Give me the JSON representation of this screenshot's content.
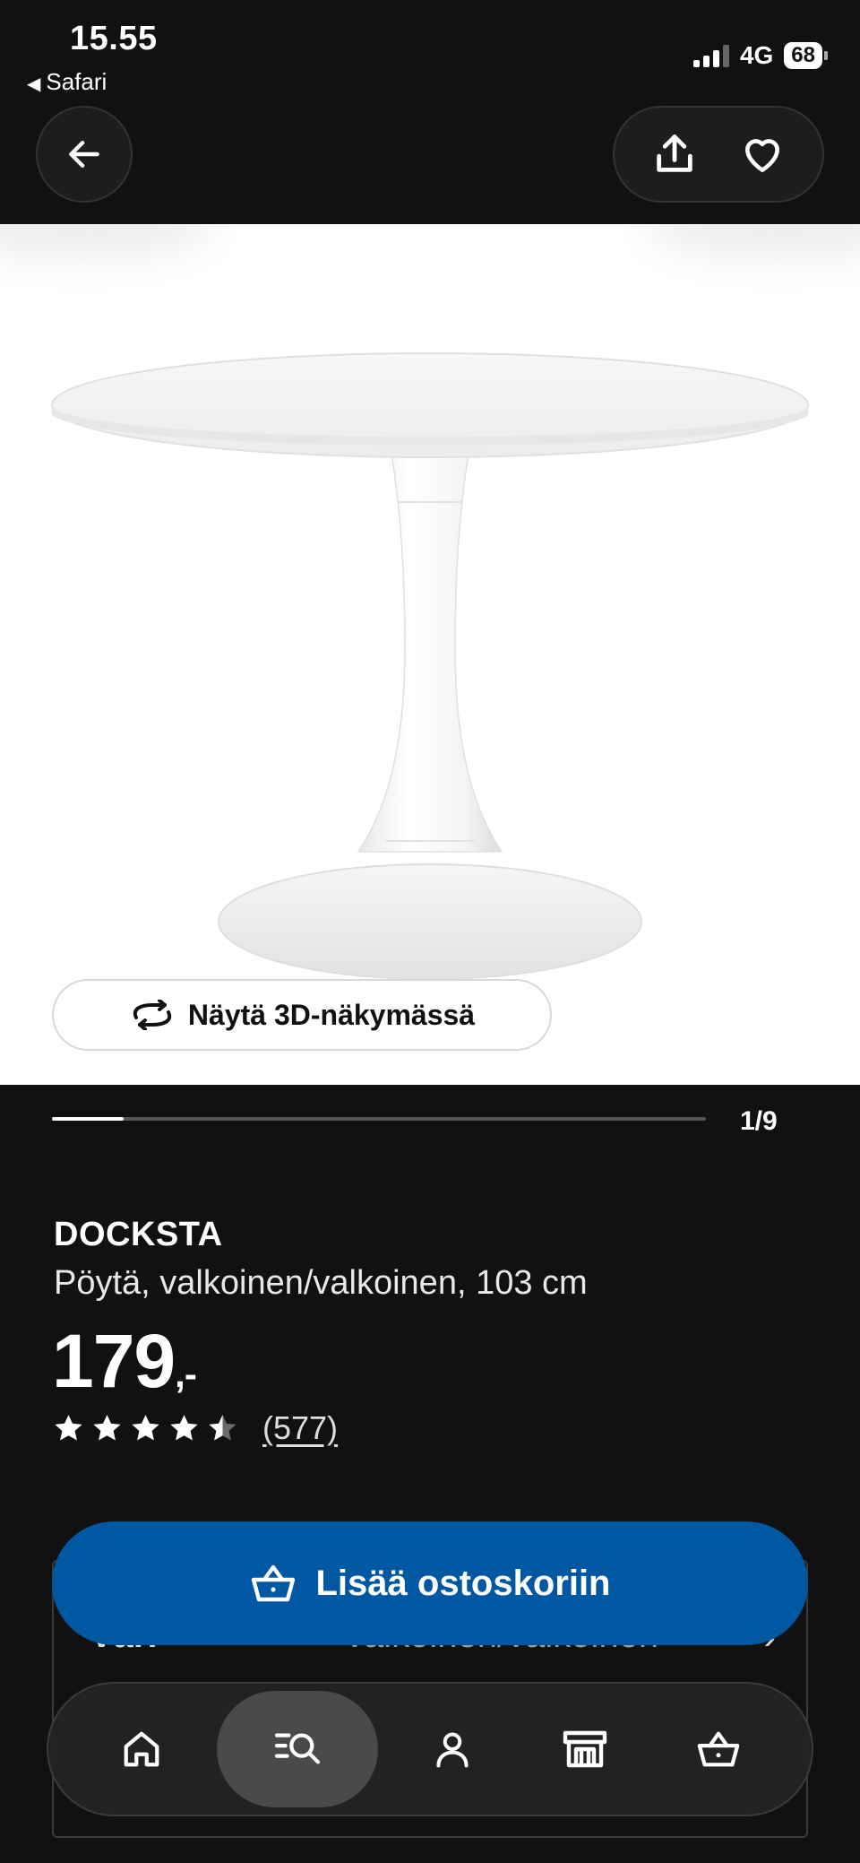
{
  "status_bar": {
    "time": "15.55",
    "back_app": "Safari",
    "network": "4G",
    "battery": "68"
  },
  "icons": {
    "back": "arrow-left-icon",
    "share": "share-icon",
    "favorite": "heart-icon",
    "rotate_3d": "rotate-icon",
    "cart": "basket-icon",
    "home": "home-icon",
    "search": "search-list-icon",
    "profile": "person-icon",
    "store": "store-icon",
    "basket": "basket-icon"
  },
  "hero": {
    "view_3d_label": "Näytä 3D-näkymässä"
  },
  "pager": {
    "label": "1/9",
    "progress": 0.11
  },
  "product": {
    "name": "DOCKSTA",
    "description": "Pöytä, valkoinen/valkoinen, 103 cm",
    "price": "179",
    "price_suffix": ",-",
    "rating": 4.5,
    "rating_max": 5,
    "review_count": "(577)"
  },
  "variant": {
    "label": "Väri",
    "value": "valkoinen/valkoinen"
  },
  "actions": {
    "add_to_cart": "Lisää ostoskoriin"
  },
  "colors": {
    "background": "#111111",
    "accent": "#0058a3",
    "surface": "#1d1d1d"
  }
}
